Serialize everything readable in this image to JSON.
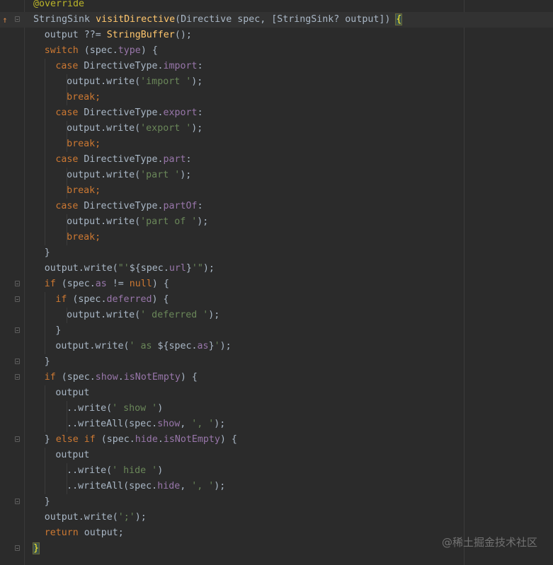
{
  "editor": {
    "lines": [
      {
        "indent": 0,
        "fold": false,
        "tokens": [
          [
            "ann",
            "@override"
          ]
        ]
      },
      {
        "indent": 0,
        "fold": true,
        "override_mark": true,
        "current": true,
        "tokens": [
          [
            "plain",
            "StringSink "
          ],
          [
            "fn",
            "visitDirective"
          ],
          [
            "plain",
            "(Directive spec, [StringSink? output]) "
          ],
          [
            "brace",
            "{"
          ]
        ]
      },
      {
        "indent": 1,
        "fold": false,
        "tokens": [
          [
            "plain",
            "output ??= "
          ],
          [
            "fn",
            "StringBuffer"
          ],
          [
            "plain",
            "();"
          ]
        ]
      },
      {
        "indent": 1,
        "fold": false,
        "tokens": [
          [
            "kw",
            "switch"
          ],
          [
            "plain",
            " (spec."
          ],
          [
            "field",
            "type"
          ],
          [
            "plain",
            ") {"
          ]
        ]
      },
      {
        "indent": 2,
        "fold": false,
        "tokens": [
          [
            "kw",
            "case"
          ],
          [
            "plain",
            " DirectiveType."
          ],
          [
            "field",
            "import"
          ],
          [
            "plain",
            ":"
          ]
        ]
      },
      {
        "indent": 3,
        "fold": false,
        "tokens": [
          [
            "plain",
            "output.write("
          ],
          [
            "str",
            "'import '"
          ],
          [
            "plain",
            ");"
          ]
        ]
      },
      {
        "indent": 3,
        "fold": false,
        "tokens": [
          [
            "kw",
            "break"
          ],
          [
            "kw",
            ";"
          ]
        ]
      },
      {
        "indent": 2,
        "fold": false,
        "tokens": [
          [
            "kw",
            "case"
          ],
          [
            "plain",
            " DirectiveType."
          ],
          [
            "field",
            "export"
          ],
          [
            "plain",
            ":"
          ]
        ]
      },
      {
        "indent": 3,
        "fold": false,
        "tokens": [
          [
            "plain",
            "output.write("
          ],
          [
            "str",
            "'export '"
          ],
          [
            "plain",
            ");"
          ]
        ]
      },
      {
        "indent": 3,
        "fold": false,
        "tokens": [
          [
            "kw",
            "break"
          ],
          [
            "kw",
            ";"
          ]
        ]
      },
      {
        "indent": 2,
        "fold": false,
        "tokens": [
          [
            "kw",
            "case"
          ],
          [
            "plain",
            " DirectiveType."
          ],
          [
            "field",
            "part"
          ],
          [
            "plain",
            ":"
          ]
        ]
      },
      {
        "indent": 3,
        "fold": false,
        "tokens": [
          [
            "plain",
            "output.write("
          ],
          [
            "str",
            "'part '"
          ],
          [
            "plain",
            ");"
          ]
        ]
      },
      {
        "indent": 3,
        "fold": false,
        "tokens": [
          [
            "kw",
            "break"
          ],
          [
            "kw",
            ";"
          ]
        ]
      },
      {
        "indent": 2,
        "fold": false,
        "tokens": [
          [
            "kw",
            "case"
          ],
          [
            "plain",
            " DirectiveType."
          ],
          [
            "field",
            "partOf"
          ],
          [
            "plain",
            ":"
          ]
        ]
      },
      {
        "indent": 3,
        "fold": false,
        "tokens": [
          [
            "plain",
            "output.write("
          ],
          [
            "str",
            "'part of '"
          ],
          [
            "plain",
            ");"
          ]
        ]
      },
      {
        "indent": 3,
        "fold": false,
        "tokens": [
          [
            "kw",
            "break"
          ],
          [
            "kw",
            ";"
          ]
        ]
      },
      {
        "indent": 1,
        "fold": false,
        "tokens": [
          [
            "plain",
            "}"
          ]
        ]
      },
      {
        "indent": 1,
        "fold": false,
        "tokens": [
          [
            "plain",
            "output.write("
          ],
          [
            "str",
            "\"'"
          ],
          [
            "plain",
            "${spec."
          ],
          [
            "field",
            "url"
          ],
          [
            "plain",
            "}"
          ],
          [
            "str",
            "'\""
          ],
          [
            "plain",
            ");"
          ]
        ]
      },
      {
        "indent": 1,
        "fold": true,
        "tokens": [
          [
            "kw",
            "if"
          ],
          [
            "plain",
            " (spec."
          ],
          [
            "field",
            "as"
          ],
          [
            "plain",
            " != "
          ],
          [
            "kw",
            "null"
          ],
          [
            "plain",
            ") {"
          ]
        ]
      },
      {
        "indent": 2,
        "fold": true,
        "tokens": [
          [
            "kw",
            "if"
          ],
          [
            "plain",
            " (spec."
          ],
          [
            "field",
            "deferred"
          ],
          [
            "plain",
            ") {"
          ]
        ]
      },
      {
        "indent": 3,
        "fold": false,
        "tokens": [
          [
            "plain",
            "output.write("
          ],
          [
            "str",
            "' deferred '"
          ],
          [
            "plain",
            ");"
          ]
        ]
      },
      {
        "indent": 2,
        "fold": true,
        "tokens": [
          [
            "plain",
            "}"
          ]
        ]
      },
      {
        "indent": 2,
        "fold": false,
        "tokens": [
          [
            "plain",
            "output.write("
          ],
          [
            "str",
            "' as "
          ],
          [
            "plain",
            "${spec."
          ],
          [
            "field",
            "as"
          ],
          [
            "plain",
            "}"
          ],
          [
            "str",
            "'"
          ],
          [
            "plain",
            ");"
          ]
        ]
      },
      {
        "indent": 1,
        "fold": true,
        "tokens": [
          [
            "plain",
            "}"
          ]
        ]
      },
      {
        "indent": 1,
        "fold": true,
        "tokens": [
          [
            "kw",
            "if"
          ],
          [
            "plain",
            " (spec."
          ],
          [
            "field",
            "show"
          ],
          [
            "plain",
            "."
          ],
          [
            "field",
            "isNotEmpty"
          ],
          [
            "plain",
            ") {"
          ]
        ]
      },
      {
        "indent": 2,
        "fold": false,
        "tokens": [
          [
            "plain",
            "output"
          ]
        ]
      },
      {
        "indent": 3,
        "fold": false,
        "tokens": [
          [
            "plain",
            "..write("
          ],
          [
            "str",
            "' show '"
          ],
          [
            "plain",
            ")"
          ]
        ]
      },
      {
        "indent": 3,
        "fold": false,
        "tokens": [
          [
            "plain",
            "..writeAll(spec."
          ],
          [
            "field",
            "show"
          ],
          [
            "plain",
            ", "
          ],
          [
            "str",
            "', '"
          ],
          [
            "plain",
            ");"
          ]
        ]
      },
      {
        "indent": 1,
        "fold": true,
        "tokens": [
          [
            "plain",
            "} "
          ],
          [
            "kw",
            "else if"
          ],
          [
            "plain",
            " (spec."
          ],
          [
            "field",
            "hide"
          ],
          [
            "plain",
            "."
          ],
          [
            "field",
            "isNotEmpty"
          ],
          [
            "plain",
            ") {"
          ]
        ]
      },
      {
        "indent": 2,
        "fold": false,
        "tokens": [
          [
            "plain",
            "output"
          ]
        ]
      },
      {
        "indent": 3,
        "fold": false,
        "tokens": [
          [
            "plain",
            "..write("
          ],
          [
            "str",
            "' hide '"
          ],
          [
            "plain",
            ")"
          ]
        ]
      },
      {
        "indent": 3,
        "fold": false,
        "tokens": [
          [
            "plain",
            "..writeAll(spec."
          ],
          [
            "field",
            "hide"
          ],
          [
            "plain",
            ", "
          ],
          [
            "str",
            "', '"
          ],
          [
            "plain",
            ");"
          ]
        ]
      },
      {
        "indent": 1,
        "fold": true,
        "tokens": [
          [
            "plain",
            "}"
          ]
        ]
      },
      {
        "indent": 1,
        "fold": false,
        "tokens": [
          [
            "plain",
            "output.write("
          ],
          [
            "str",
            "';'"
          ],
          [
            "plain",
            ");"
          ]
        ]
      },
      {
        "indent": 1,
        "fold": false,
        "tokens": [
          [
            "kw",
            "return"
          ],
          [
            "plain",
            " output;"
          ]
        ]
      },
      {
        "indent": 0,
        "fold": true,
        "tokens": [
          [
            "brace",
            "}"
          ]
        ]
      }
    ]
  },
  "icons": {
    "override_mark": "override-up-arrow-icon",
    "fold": "fold-marker-icon"
  },
  "colors": {
    "background": "#2b2b2b",
    "keyword": "#cc7832",
    "function": "#ffc66d",
    "string": "#6a8759",
    "field": "#9876aa",
    "annotation": "#bbb529",
    "plain": "#a9b7c6"
  },
  "watermark": "@稀土掘金技术社区"
}
